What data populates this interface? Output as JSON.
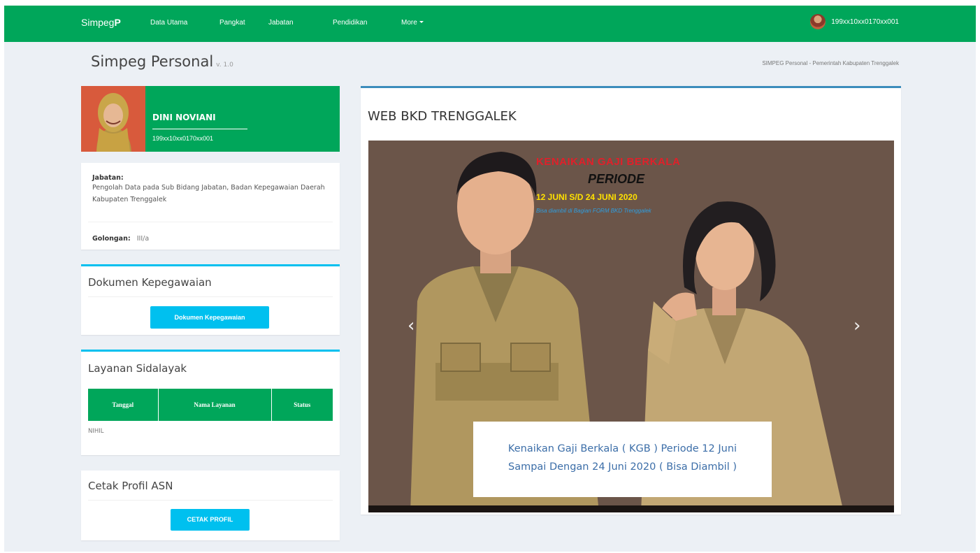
{
  "navbar": {
    "brand_main": "Simpeg",
    "brand_suffix": "P",
    "items": [
      {
        "label": "Data Utama"
      },
      {
        "label": "Pangkat"
      },
      {
        "label": "Jabatan"
      },
      {
        "label": "Pendidikan"
      },
      {
        "label": "More"
      }
    ],
    "user_id": "199xx10xx0170xx001"
  },
  "header": {
    "title": "Simpeg Personal",
    "version": "v. 1.0",
    "breadcrumb": "SIMPEG Personal - Pemerintah Kabupaten Trenggalek"
  },
  "profile": {
    "name": "DINI NOVIANI",
    "nip": "199xx10xx0170xx001"
  },
  "info": {
    "jabatan_label": "Jabatan:",
    "jabatan_value": "Pengolah Data pada Sub Bidang Jabatan, Badan Kepegawaian Daerah Kabupaten Trenggalek",
    "golongan_label": "Golongan:",
    "golongan_value": "III/a"
  },
  "dokumen": {
    "title": "Dokumen Kepegawaian",
    "button": "Dokumen Kepegawaian"
  },
  "layanan": {
    "title": "Layanan Sidalayak",
    "columns": [
      "Tanggal",
      "Nama Layanan",
      "Status"
    ],
    "empty_text": "NIHIL"
  },
  "cetak": {
    "title": "Cetak Profil ASN",
    "button": "CETAK PROFIL"
  },
  "main": {
    "title": "WEB BKD TRENGGALEK",
    "poster": {
      "line1": "KENAIKAN GAJI BERKALA",
      "line2": "PERIODE",
      "line3": "12 JUNI S/D 24 JUNI 2020",
      "line4": "Bisa diambil di Bagian FORM BKD Trenggalek"
    },
    "caption_line1": "Kenaikan Gaji Berkala ( KGB ) Periode 12 Juni",
    "caption_line2": "Sampai Dengan 24 Juni 2020 ( Bisa Diambil )",
    "prev_icon": "chevron-left-icon",
    "next_icon": "chevron-right-icon"
  },
  "colors": {
    "nav_green": "#00a65a",
    "info_blue": "#00c0ef",
    "primary_blue": "#3c8dbc",
    "background": "#ecf0f5"
  }
}
